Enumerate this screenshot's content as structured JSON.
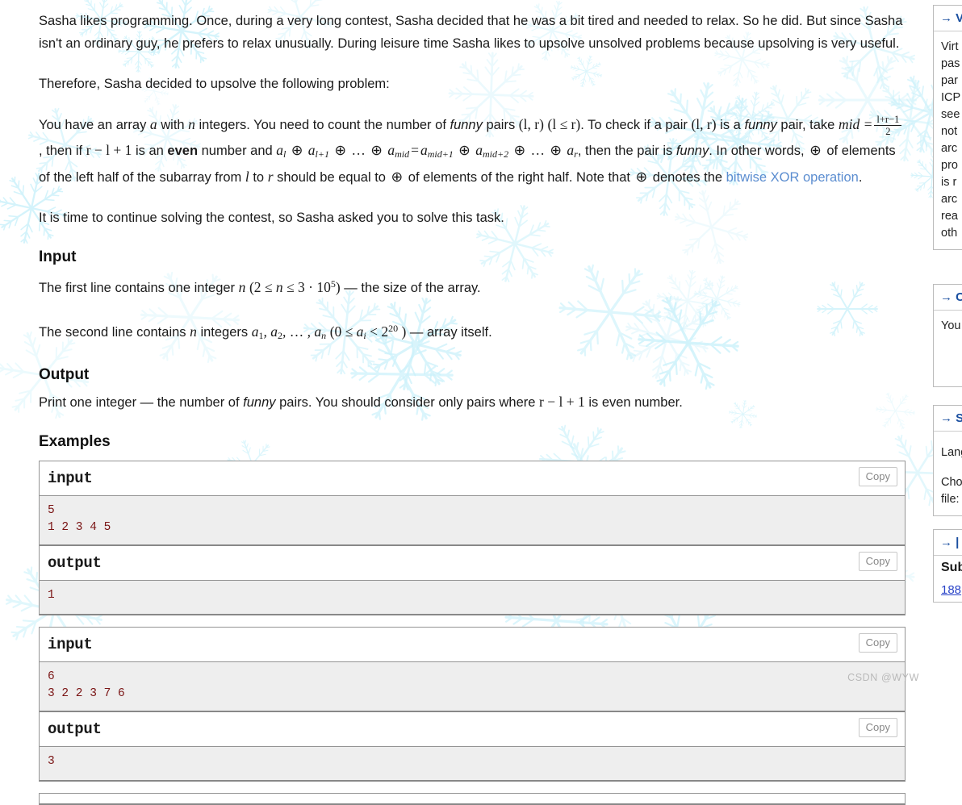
{
  "statement": {
    "intro": "Sasha likes programming. Once, during a very long contest, Sasha decided that he was a bit tired and needed to relax. So he did. But since Sasha isn't an ordinary guy, he prefers to relax unusually. During leisure time Sasha likes to upsolve unsolved problems because upsolving is very useful.",
    "therefore": "Therefore, Sasha decided to upsolve the following problem:",
    "body_1a": "You have an array ",
    "body_1b": " with ",
    "body_1c": " integers. You need to count the number of ",
    "funny_word": "funny",
    "body_1d": " pairs ",
    "body_1e": ". To check if a pair ",
    "body_1f": " is a ",
    "body_1g": " pair, take ",
    "body_1h": ", then if ",
    "body_1i": " is an ",
    "even_word": "even",
    "body_1j": " number and ",
    "body_1k": ", then the pair is ",
    "body_1l": ". In other words, ",
    "body_1m": " of elements of the left half of the subarray from ",
    "body_1n": " to ",
    "body_1o": " should be equal to ",
    "body_1p": " of elements of the right half. Note that ",
    "body_1q": " denotes the ",
    "xor_link": "bitwise XOR operation",
    "body_1r": ".",
    "continue": "It is time to continue solving the contest, so Sasha asked you to solve this task."
  },
  "math": {
    "a": "a",
    "n": "n",
    "l": "l",
    "r": "r",
    "mid": "mid",
    "pair_lr": "(l, r)",
    "pair_lr_le": "(l ≤ r)",
    "mid_eq": "mid =",
    "frac_num": "l+r−1",
    "frac_den": "2",
    "rl1": "r − l + 1",
    "xor_sym": "⊕",
    "xor_eq_left": "aₗ ⊕ aₗ₊₁ ⊕ … ⊕ a_mid",
    "xor_eq_right": "a_mid+1 ⊕ a_mid+2 ⊕ … ⊕ a_r",
    "equals": "=",
    "dots": "…",
    "n_range": "(2 ≤ n ≤ 3 · 10⁵)",
    "a_range": "(0 ≤ aᵢ < 2²⁰)"
  },
  "input_section": {
    "title": "Input",
    "line1_a": "The first line contains one integer ",
    "line1_b": " — the size of the array.",
    "line2_a": "The second line contains ",
    "line2_b": " integers ",
    "line2_c": " — array itself."
  },
  "output_section": {
    "title": "Output",
    "text_a": "Print one integer — the number of ",
    "funny_word": "funny",
    "text_b": " pairs. You should consider only pairs where ",
    "text_c": " is even number."
  },
  "examples_section": {
    "title": "Examples",
    "copy_label": "Copy",
    "input_label": "input",
    "output_label": "output",
    "tests": [
      {
        "input": "5\n1 2 3 4 5",
        "output": "1"
      },
      {
        "input": "6\n3 2 2 3 7 6",
        "output": "3"
      }
    ]
  },
  "sidebar": {
    "panels": [
      {
        "header": "→ V",
        "lines": [
          "Virt",
          "pas",
          "par",
          "ICP",
          "see",
          "not",
          "arc",
          "pro",
          "is r",
          "arc",
          "rea",
          "oth"
        ]
      },
      {
        "header": "→ C",
        "lines": [
          "You"
        ]
      },
      {
        "header": "→ S",
        "lines": [
          "Lang",
          "",
          "Cho",
          "file:"
        ]
      }
    ],
    "submissions": {
      "header": "→ |",
      "title": "Sub",
      "link": "188"
    }
  },
  "watermark": "CSDN @WYW",
  "colors": {
    "link": "#5b8dd0",
    "sample_text": "#7a1414",
    "sample_bg": "#eeeeee",
    "snowflake": "#cdf2fb"
  }
}
